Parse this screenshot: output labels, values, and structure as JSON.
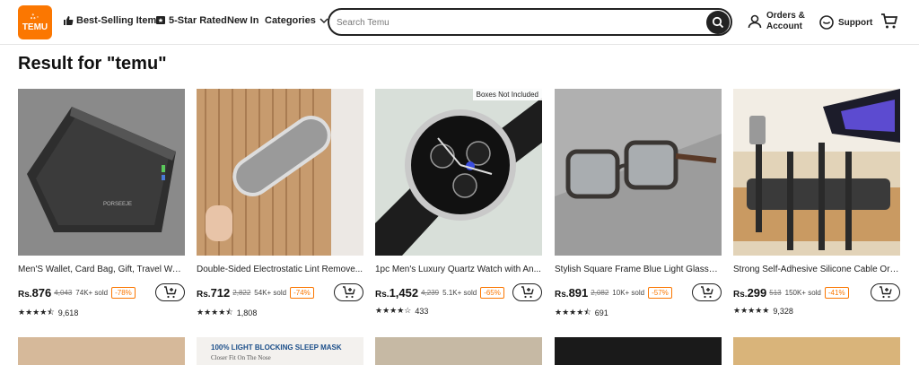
{
  "header": {
    "logo_top": "ஃ◦",
    "logo_text": "TEMU",
    "nav": {
      "best_selling": "Best-Selling Items",
      "five_star": "5-Star Rated",
      "new_in": "New In",
      "categories": "Categories"
    },
    "search_placeholder": "Search Temu",
    "orders_line1": "Orders &",
    "orders_line2": "Account",
    "support": "Support"
  },
  "page_title": "Result for \"temu\"",
  "currency": "Rs.",
  "products": [
    {
      "name": "Men'S Wallet, Card Bag, Gift, Travel Wall...",
      "price": "876",
      "old_price": "4,043",
      "sold": "74K+ sold",
      "discount": "-78%",
      "stars": "★★★★⯪",
      "reviews": "9,618",
      "image": "wallet"
    },
    {
      "name": "Double-Sided Electrostatic Lint Remove...",
      "price": "712",
      "old_price": "2,822",
      "sold": "54K+ sold",
      "discount": "-74%",
      "stars": "★★★★⯪",
      "reviews": "1,808",
      "image": "lint-roller"
    },
    {
      "name": "1pc Men's Luxury Quartz Watch with An...",
      "price": "1,452",
      "old_price": "4,239",
      "sold": "5.1K+ sold",
      "discount": "-65%",
      "stars": "★★★★☆",
      "reviews": "433",
      "image": "watch",
      "badge": "Boxes Not Included"
    },
    {
      "name": "Stylish Square Frame Blue Light Glasses ...",
      "price": "891",
      "old_price": "2,082",
      "sold": "10K+ sold",
      "discount": "-57%",
      "stars": "★★★★⯪",
      "reviews": "691",
      "image": "glasses"
    },
    {
      "name": "Strong Self-Adhesive Silicone Cable Org...",
      "price": "299",
      "old_price": "513",
      "sold": "150K+ sold",
      "discount": "-41%",
      "stars": "★★★★★",
      "reviews": "9,328",
      "image": "cable-organizer"
    }
  ],
  "row2": {
    "sleep_mask_title": "100% LIGHT BLOCKING SLEEP MASK",
    "sleep_mask_sub": "Closer Fit On The Nose"
  },
  "colors": {
    "brand": "#fb7701",
    "text": "#222222"
  }
}
